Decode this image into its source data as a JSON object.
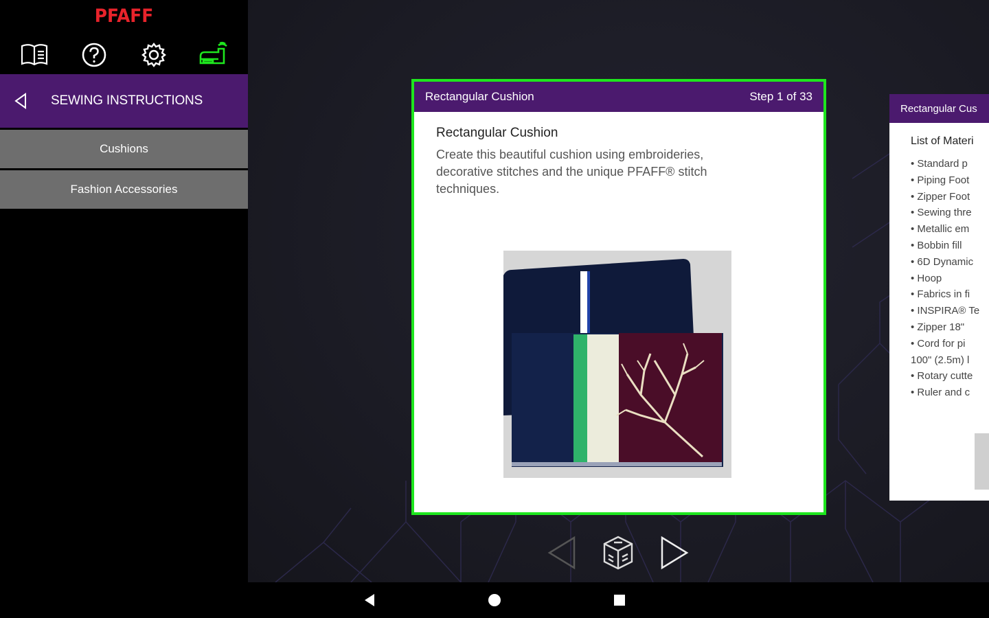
{
  "app": {
    "brand": "PFAFF"
  },
  "toolbar": {
    "icons": [
      "book-icon",
      "help-icon",
      "settings-icon",
      "sewing-machine-icon"
    ],
    "accent": "#1ee61e"
  },
  "sidebar": {
    "header": "SEWING INSTRUCTIONS",
    "items": [
      {
        "label": "Cushions"
      },
      {
        "label": "Fashion Accessories"
      }
    ]
  },
  "card": {
    "header_title": "Rectangular Cushion",
    "step": "Step 1 of 33",
    "title": "Rectangular Cushion",
    "description": "Create this beautiful cushion using embroideries, decorative stitches and the unique PFAFF® stitch techniques."
  },
  "next_card": {
    "header_title": "Rectangular Cus",
    "title": "List of Materi",
    "items": [
      "• Standard p",
      "• Piping Foot",
      "• Zipper Foot",
      "• Sewing thre",
      "• Metallic em",
      "• Bobbin fill",
      "• 6D Dynamic",
      "• Hoop",
      "• Fabrics in fi",
      "• INSPIRA® Te",
      "• Zipper 18\"",
      "• Cord for pi",
      "100\" (2.5m) l",
      "• Rotary cutte",
      "• Ruler and c"
    ]
  },
  "colors": {
    "brand_red": "#e8232b",
    "purple": "#4b1a6e",
    "menu_gray": "#6e6e6e",
    "selection_green": "#1ee61e"
  }
}
